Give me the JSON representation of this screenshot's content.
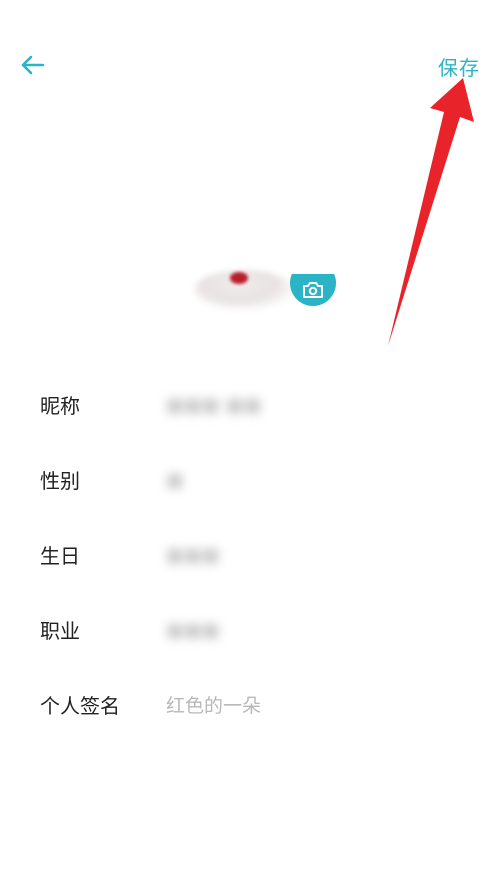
{
  "header": {
    "back_icon": "arrow-left-icon",
    "save_label": "保存",
    "accent_color": "#2bb3c6"
  },
  "avatar": {
    "camera_icon": "camera-icon"
  },
  "profile_fields": [
    {
      "label": "昵称",
      "value": "■■■ ■■"
    },
    {
      "label": "性别",
      "value": "■"
    },
    {
      "label": "生日",
      "value": "■■■"
    },
    {
      "label": "职业",
      "value": "■■■"
    },
    {
      "label": "个人签名",
      "value": "红色的一朵"
    }
  ],
  "annotation": {
    "arrow_color": "#e8242a"
  }
}
